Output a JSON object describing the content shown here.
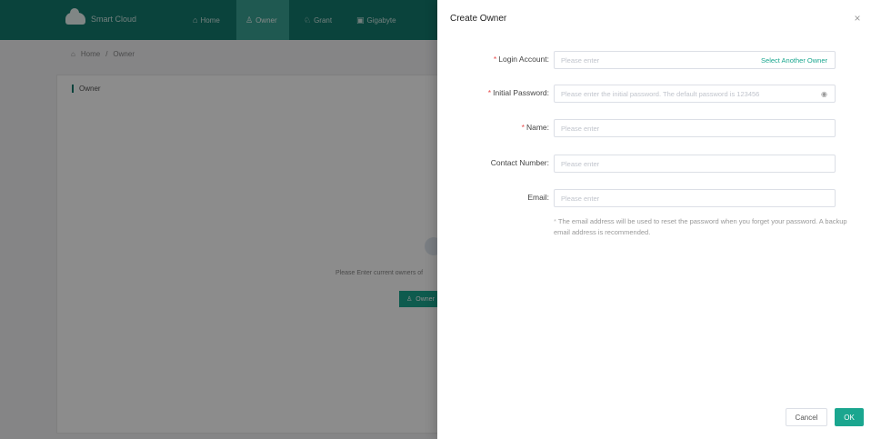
{
  "app": {
    "brand": "Smart Cloud",
    "nav": [
      {
        "label": "Home",
        "icon": "home-icon"
      },
      {
        "label": "Owner",
        "icon": "owner-icon"
      },
      {
        "label": "Grant",
        "icon": "grant-icon"
      },
      {
        "label": "Gigabyte",
        "icon": "device-icon"
      }
    ],
    "breadcrumb": [
      "Home",
      "Owner"
    ],
    "content_title": "Owner",
    "empty_text": "Please Enter current owners of",
    "empty_button": "Owner"
  },
  "drawer": {
    "title": "Create Owner",
    "close_symbol": "×",
    "fields": {
      "login_account": {
        "label": "Login Account:",
        "placeholder": "Please enter",
        "suffix": "Select Another Owner",
        "required": "*"
      },
      "initial_password": {
        "label": "Initial Password:",
        "placeholder": "Please enter the initial password. The default password is 123456",
        "required": "*"
      },
      "name": {
        "label": "Name:",
        "placeholder": "Please enter",
        "required": "*"
      },
      "contact_number": {
        "label": "Contact Number:",
        "placeholder": "Please enter"
      },
      "email": {
        "label": "Email:",
        "placeholder": "Please enter"
      }
    },
    "hint_star": "*",
    "hint": "The email address will be used to reset the password when you forget your password. A backup email address is recommended.",
    "cancel_label": "Cancel",
    "ok_label": "OK"
  }
}
